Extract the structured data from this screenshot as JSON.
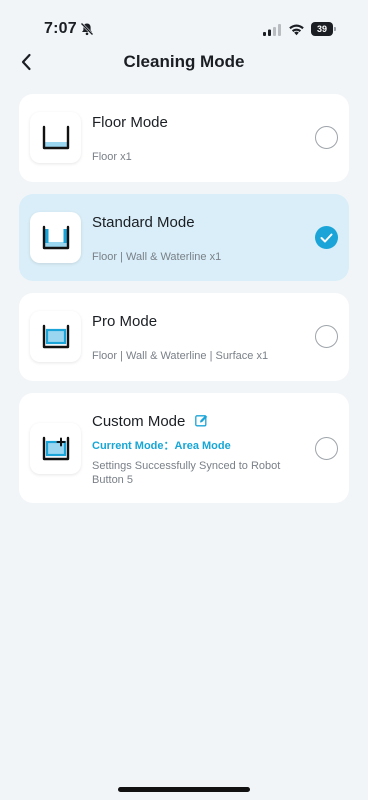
{
  "status_bar": {
    "time": "7:07",
    "battery": "39"
  },
  "header": {
    "title": "Cleaning Mode",
    "back_icon": "chevron-left-icon"
  },
  "modes": [
    {
      "title": "Floor Mode",
      "description": "Floor x1",
      "selected": false,
      "icon": "floor-mode-icon"
    },
    {
      "title": "Standard Mode",
      "description": "Floor | Wall & Waterline x1",
      "selected": true,
      "icon": "standard-mode-icon"
    },
    {
      "title": "Pro Mode",
      "description": "Floor | Wall & Waterline | Surface x1",
      "selected": false,
      "icon": "pro-mode-icon"
    },
    {
      "title": "Custom Mode",
      "current_mode": "Current Mode：Area Mode",
      "description": "Settings Successfully Synced to Robot Button 5",
      "selected": false,
      "icon": "custom-mode-icon"
    }
  ],
  "colors": {
    "accent": "#1aa4d8",
    "selected_card_bg": "#d9eef8",
    "background": "#f2f5f8"
  }
}
